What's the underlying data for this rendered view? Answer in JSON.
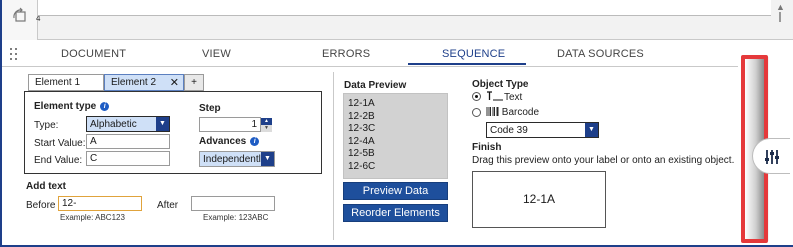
{
  "top": {
    "ruler_mark": "4",
    "scroll_up": "▲"
  },
  "tabs": [
    {
      "label": "DOCUMENT"
    },
    {
      "label": "VIEW"
    },
    {
      "label": "ERRORS"
    },
    {
      "label": "SEQUENCE"
    },
    {
      "label": "DATA SOURCES"
    }
  ],
  "active_tab": "SEQUENCE",
  "element_tabs": [
    {
      "label": "Element 1"
    },
    {
      "label": "Element 2",
      "close": "✕"
    },
    {
      "label": "+"
    }
  ],
  "element": {
    "heading": "Element type",
    "type_label": "Type:",
    "type_value": "Alphabetic",
    "start_label": "Start Value:",
    "start_value": "A",
    "end_label": "End Value:",
    "end_value": "C"
  },
  "step": {
    "heading": "Step",
    "value": "1",
    "advances_heading": "Advances",
    "advances_value": "Independently"
  },
  "add_text": {
    "heading": "Add text",
    "before_label": "Before",
    "before_value": "12-",
    "before_example": "Example: ABC123",
    "after_label": "After",
    "after_value": "",
    "after_example": "Example: 123ABC"
  },
  "preview": {
    "heading": "Data Preview",
    "items": [
      "12-1A",
      "12-2B",
      "12-3C",
      "12-4A",
      "12-5B",
      "12-6C"
    ],
    "preview_button": "Preview Data",
    "reorder_button": "Reorder Elements"
  },
  "object_type": {
    "heading": "Object Type",
    "text_option": "Text",
    "barcode_option": "Barcode",
    "barcode_symbology": "Code 39",
    "selected": "Text"
  },
  "finish": {
    "heading": "Finish",
    "instructions": "Drag this preview onto your label or onto an existing object.",
    "preview_value": "12-1A"
  },
  "colors": {
    "accent": "#1e3f8a",
    "button": "#1e4f9c",
    "highlight": "#e5393b",
    "focus": "#e0a33c"
  }
}
